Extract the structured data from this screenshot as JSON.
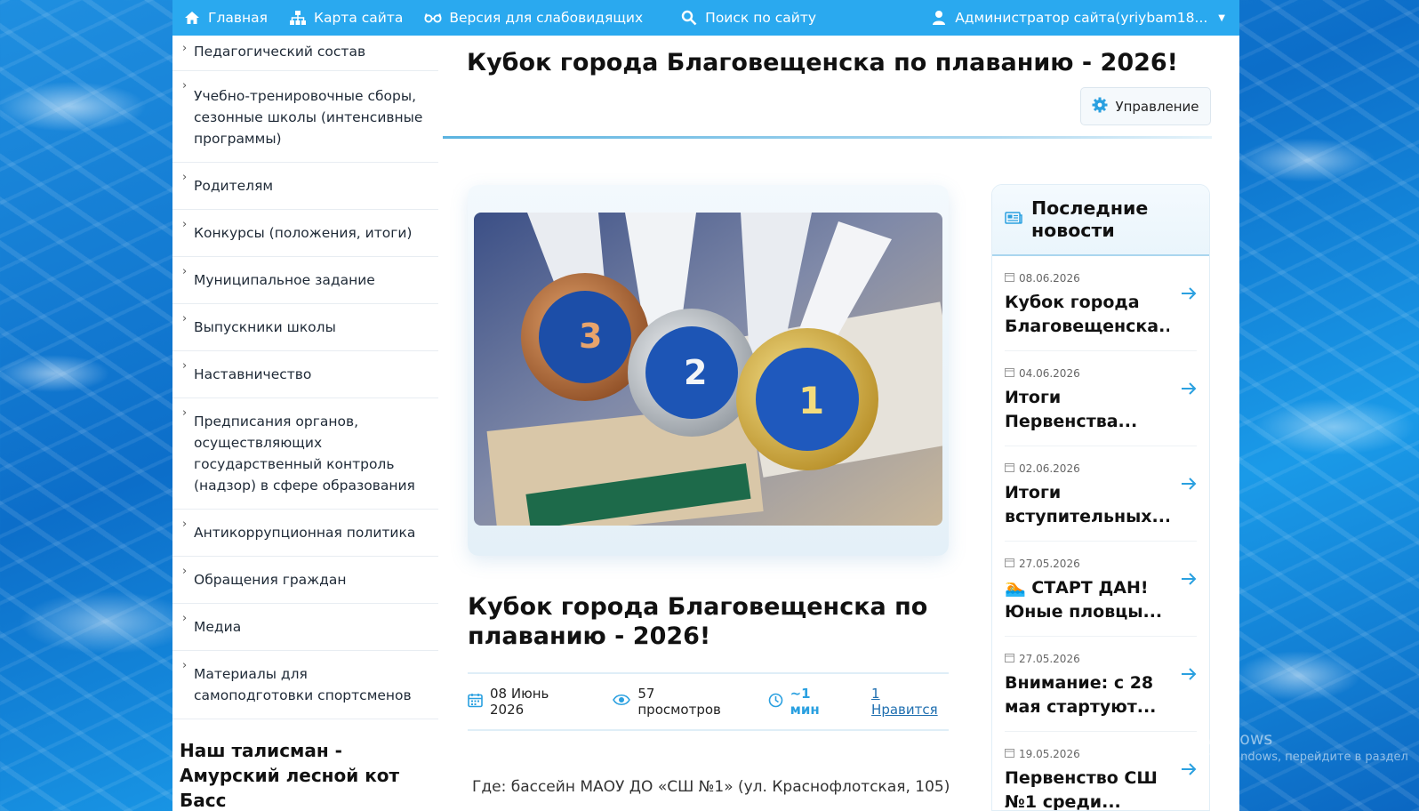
{
  "topnav": {
    "home": "Главная",
    "sitemap": "Карта сайта",
    "accessible": "Версия для слабовидящих",
    "search": "Поиск по сайту",
    "admin": "Администратор сайта(yriybam18..."
  },
  "sidebar": {
    "items": [
      "Педагогический состав",
      "Учебно-тренировочные сборы, сезонные школы (интенсивные программы)",
      "Родителям",
      "Конкурсы (положения, итоги)",
      "Муниципальное задание",
      "Выпускники школы",
      "Наставничество",
      "Предписания органов, осуществляющих государственный контроль (надзор) в сфере образования",
      "Антикоррупционная политика",
      "Обращения граждан",
      "Медиа",
      "Материалы для самоподготовки спортсменов"
    ],
    "mascot_title": "Наш талисман - Амурский лесной кот Басс"
  },
  "page": {
    "title": "Кубок города Благовещенска по плаванию - 2026!",
    "manage_label": "Управление"
  },
  "article": {
    "title": "Кубок города Благовещенска по плаванию - 2026!",
    "date": "08 Июнь 2026",
    "views": "57 просмотров",
    "read_time": "~1 мин",
    "likes": "1 Нравится",
    "venue": "Где: бассейн МАОУ ДО «СШ №1» (ул. Краснофлотская, 105)"
  },
  "news": {
    "heading": "Последние новости",
    "items": [
      {
        "date": "08.06.2026",
        "title": "Кубок города Благовещенска..."
      },
      {
        "date": "04.06.2026",
        "title": "Итоги Первенства..."
      },
      {
        "date": "02.06.2026",
        "title": "Итоги вступительных..."
      },
      {
        "date": "27.05.2026",
        "title": "🏊 СТАРТ ДАН! Юные пловцы..."
      },
      {
        "date": "27.05.2026",
        "title": "Внимание: с 28 мая стартуют..."
      },
      {
        "date": "19.05.2026",
        "title": "Первенство СШ №1 среди..."
      }
    ]
  },
  "watermark": {
    "line1": "Активация Windows",
    "line2": "Чтобы активировать Windows, перейдите в раздел"
  },
  "colors": {
    "topbar": "#2aa9ef",
    "accent": "#2aa0e0"
  }
}
